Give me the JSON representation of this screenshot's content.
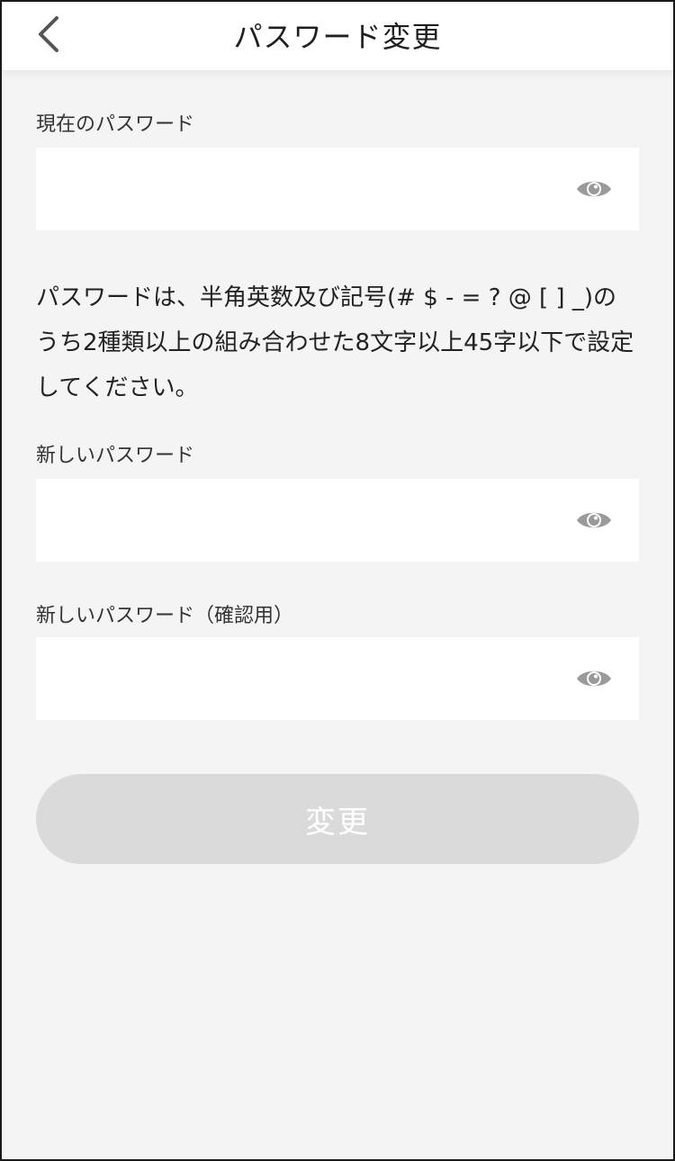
{
  "header": {
    "title": "パスワード変更",
    "back_icon": "chevron-left-icon"
  },
  "current_password": {
    "label": "現在のパスワード",
    "value": "",
    "toggle_icon": "eye-icon"
  },
  "help_text": "パスワードは、半角英数及び記号(# $ - = ? @ [ ] _)のうち2種類以上の組み合わせた8文字以上45字以下で設定してください。",
  "new_password": {
    "label": "新しいパスワード",
    "value": "",
    "toggle_icon": "eye-icon"
  },
  "confirm_password": {
    "label": "新しいパスワード（確認用）",
    "value": "",
    "toggle_icon": "eye-icon"
  },
  "submit": {
    "label": "変更",
    "enabled": false
  },
  "colors": {
    "background": "#f4f4f4",
    "header_bg": "#ffffff",
    "field_bg": "#ffffff",
    "button_disabled_bg": "#dadada",
    "button_text": "#ffffff",
    "icon": "#9a9a9a"
  }
}
